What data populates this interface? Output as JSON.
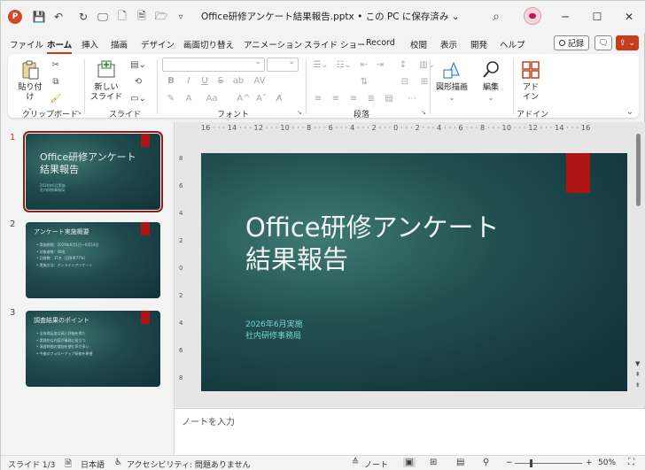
{
  "titlebar": {
    "document_title": "Office研修アンケート結果報告.pptx • この PC に保存済み ⌄",
    "app_logo": "P",
    "icons": [
      "save-icon",
      "undo-icon",
      "redo-icon",
      "present-icon",
      "new-icon",
      "print-preview-icon",
      "open-icon",
      "customize-icon",
      "search-icon"
    ],
    "glyphs": {
      "save": "💾",
      "undo": "↶",
      "redo": "↻",
      "present": "🖵",
      "new": "🗋",
      "preview": "🗎",
      "open": "🗁",
      "customize": "▿",
      "search": "⌕",
      "minimize": "─",
      "maximize": "☐",
      "close": "✕"
    }
  },
  "menu": {
    "tabs": [
      "ファイル",
      "ホーム",
      "挿入",
      "描画",
      "デザイン",
      "画面切り替え",
      "アニメーション",
      "スライド ショー",
      "Record",
      "校閲",
      "表示",
      "開発",
      "ヘルプ"
    ],
    "active_tab": "ホーム",
    "record_label": "記録",
    "comment_icon": "🗨",
    "share_icon": "⇪ ⌄"
  },
  "ribbon": {
    "groups": [
      "クリップボード",
      "スライド",
      "フォント",
      "段落",
      "アドイン"
    ],
    "paste_label": "貼り付け",
    "new_slide_label": "新しい\nスライド",
    "shapes_label": "図形描画",
    "edit_label": "編集",
    "addin_label": "アド\nイン",
    "font_buttons": [
      "B",
      "I",
      "U",
      "S",
      "ab",
      "AV",
      "A",
      "Aa",
      "A^",
      "Aˇ",
      "A"
    ],
    "collapse_icon": "⌄"
  },
  "slides": {
    "numbers": [
      "1",
      "2",
      "3"
    ],
    "thumb1": {
      "title": "Office研修アンケート\n結果報告",
      "sub": "2026年6月実施\n社内研修事務局"
    },
    "thumb2": {
      "title": "アンケート実施概要",
      "bullets": [
        "• 実施期間：2026年6月1日～6月14日",
        "• 対象者数：48名",
        "• 回答数：37名（回答率77%）",
        "• 実施方法：オンラインアンケート"
      ]
    },
    "thumb3": {
      "title": "調査結果のポイント",
      "bullets": [
        "• 全体満足度は高い評価を得た",
        "• 実践的な内容が業務に役立つ",
        "• 演習時間の増加を望む声が多い",
        "• 今後のフォローアップ研修を希望"
      ]
    }
  },
  "main_slide": {
    "title": "Office研修アンケート\n結果報告",
    "subtitle": "2026年6月実施\n社内研修事務局",
    "accent_color": "#b01515"
  },
  "ruler": {
    "horizontal": "16 · · · 14 · · · 12 · · · 10 · · · 8 · · · 6 · · · 4 · · · 2 · · · 0 · · · 2 · · · 4 · · · 6 · · · 8 · · · 10 · · · 12 · · · 14 · · · 16",
    "vertical": [
      "8",
      "6",
      "4",
      "2",
      "0",
      "2",
      "4",
      "6",
      "8"
    ]
  },
  "notes": {
    "placeholder": "ノートを入力"
  },
  "status": {
    "slide_info": "スライド 1/3",
    "language": "日本語",
    "accessibility": "アクセシビリティ: 問題ありません",
    "notes_label": "ノート",
    "zoom": "50%"
  }
}
